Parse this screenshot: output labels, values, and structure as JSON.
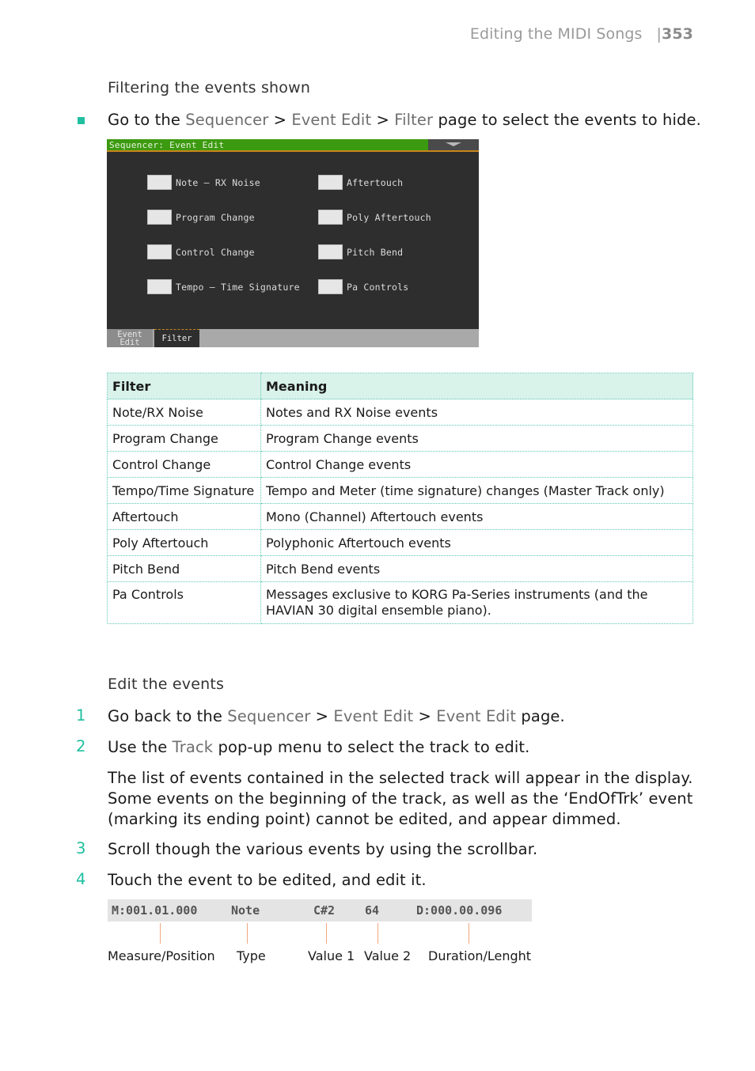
{
  "header": {
    "section_title": "Editing the MIDI Songs",
    "separator": "|",
    "page_number": "353"
  },
  "filter_section": {
    "heading": "Filtering the events shown",
    "instruction": {
      "prefix": "Go to the ",
      "path": [
        "Sequencer",
        "Event Edit",
        "Filter"
      ],
      "path_sep": " > ",
      "suffix": " page to select the events to hide."
    }
  },
  "device": {
    "title": "Sequencer: Event Edit",
    "menu_icon": "triangle-down-icon",
    "checkboxes": [
      {
        "label": "Note – RX Noise",
        "checked": false
      },
      {
        "label": "Program Change",
        "checked": false
      },
      {
        "label": "Control Change",
        "checked": false
      },
      {
        "label": "Tempo – Time Signature",
        "checked": false
      },
      {
        "label": "Aftertouch",
        "checked": false
      },
      {
        "label": "Poly Aftertouch",
        "checked": false
      },
      {
        "label": "Pitch Bend",
        "checked": false
      },
      {
        "label": "Pa Controls",
        "checked": false
      }
    ],
    "tabs": [
      {
        "label": "Event Edit",
        "active": false
      },
      {
        "label": "Filter",
        "active": true
      }
    ]
  },
  "table": {
    "headers": [
      "Filter",
      "Meaning"
    ],
    "rows": [
      [
        "Note/RX Noise",
        "Notes and RX Noise events"
      ],
      [
        "Program Change",
        "Program Change events"
      ],
      [
        "Control Change",
        "Control Change events"
      ],
      [
        "Tempo/Time Signature",
        "Tempo and Meter (time signature) changes (Master Track only)"
      ],
      [
        "Aftertouch",
        "Mono (Channel) Aftertouch events"
      ],
      [
        "Poly Aftertouch",
        "Polyphonic Aftertouch events"
      ],
      [
        "Pitch Bend",
        "Pitch Bend events"
      ],
      [
        "Pa Controls",
        "Messages exclusive to KORG Pa-Series instruments (and the HAVIAN 30 digital ensemble piano)."
      ]
    ]
  },
  "edit_section": {
    "heading": "Edit the events",
    "steps": [
      {
        "num": "1",
        "prefix": "Go back to the ",
        "path": [
          "Sequencer",
          "Event Edit",
          "Event Edit"
        ],
        "suffix": " page."
      },
      {
        "num": "2",
        "prefix": "Use the ",
        "ui": "Track",
        "suffix": " pop-up menu to select the track to edit."
      },
      {
        "num": "3",
        "text": "Scroll though the various events by using the scrollbar."
      },
      {
        "num": "4",
        "text": "Touch the event to be edited, and edit it."
      }
    ],
    "note_lines": [
      "The list of events contained in the selected track will appear in the display.",
      "Some events on the beginning of the track, as well as the ‘EndOfTrk’ event",
      "(marking its ending point) cannot be edited, and appear dimmed."
    ]
  },
  "event_line": {
    "position": "M:001.01.000",
    "type": "Note",
    "value1": "C#2",
    "value2": "64",
    "duration": "D:000.00.096",
    "captions": [
      "Measure/Position",
      "Type",
      "Value 1",
      "Value 2",
      "Duration/Lenght"
    ]
  }
}
